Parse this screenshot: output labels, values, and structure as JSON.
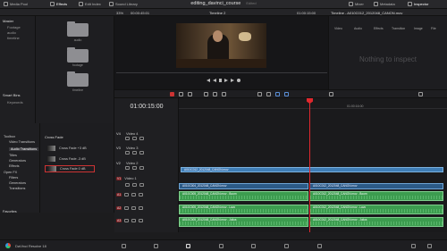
{
  "topbar": {
    "media_pool": "Media Pool",
    "effects": "Effects",
    "edit_index": "Edit Index",
    "sound_library": "Sound Library",
    "project_title": "editing_davinci_course",
    "edited": "Edited",
    "mixer": "Mixer",
    "metadata": "Metadata",
    "inspector": "Inspector"
  },
  "row2": {
    "zoom": "33%",
    "viewer_tc": "00:00:45:01",
    "timeline_name": "Timeline 2",
    "tc_right": "01:00:15:00",
    "clip_title": "Timeline - A010C012_2012048_CANON.mov"
  },
  "media_side": {
    "master": "Master",
    "items": [
      "Footage",
      "audio",
      "timeline"
    ],
    "smart_bins": "Smart Bins",
    "keywords": "Keywords"
  },
  "folders": [
    {
      "label": "audio"
    },
    {
      "label": "footage"
    },
    {
      "label": "timeline"
    }
  ],
  "inspector": {
    "tabs": [
      "Video",
      "Audio",
      "Effects",
      "Transition",
      "Image",
      "File"
    ],
    "empty": "Nothing to inspect"
  },
  "effects": {
    "side": [
      "Toolbox",
      "Video Transitions",
      "Audio Transitions",
      "Titles",
      "Generators",
      "Effects",
      "Open FX",
      "Filters",
      "Generators",
      "Transitions"
    ],
    "favorites": "Favorites",
    "list_header": "Cross Fade",
    "items": [
      "Cross Fade +3 dB",
      "Cross Fade -3 dB",
      "Cross Fade 0 dB"
    ]
  },
  "timeline": {
    "timecode": "01:00:15:00",
    "ruler_mark": "01:00:16:00",
    "tracks": [
      {
        "id": "V4",
        "name": "Video 4"
      },
      {
        "id": "V3",
        "name": "Video 3"
      },
      {
        "id": "V2",
        "name": "Video 2"
      },
      {
        "id": "V1",
        "name": "Video 1"
      },
      {
        "id": "A1",
        "name": ""
      },
      {
        "id": "A2",
        "name": ""
      },
      {
        "id": "A3",
        "name": ""
      }
    ],
    "clips": {
      "v2": "A010C012_2012048_CANON.mov",
      "v1a": "A010C004_2012048_CANON.mov",
      "v1b": "A010C012_2012048_CANON.mov",
      "a1a": "A010C005_2012048_CANON.mov - Boom",
      "a1b": "A010C012_2012048_CANON.mov - Boom",
      "a2a": "A010C005_2012048_CANON.mov - Lavo",
      "a2b": "A010C012_2012048_CANON.mov - Lavo",
      "a3a": "A010C005_2012048_CANON.mov - Julius",
      "a3b": "A010C012_2012048_CANON.mov - Julius"
    }
  },
  "bottombar": {
    "app_name": "DaVinci Resolve 18"
  }
}
